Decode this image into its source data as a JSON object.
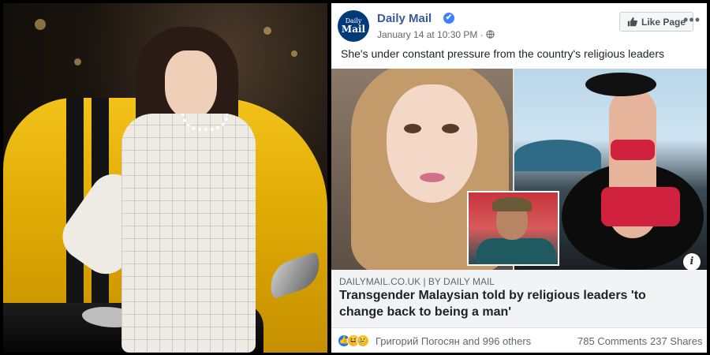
{
  "post": {
    "page_avatar_line1": "Daily",
    "page_avatar_line2": "Mail",
    "page_name": "Daily Mail",
    "verified_badge": "✔",
    "timestamp": "January 14 at 10:30 PM",
    "meta_separator": "·",
    "audience_icon": "globe-icon",
    "like_page_label": "Like Page",
    "more_icon": "more-options-icon",
    "caption": "She's under constant pressure from the country's religious leaders"
  },
  "link": {
    "source": "DAILYMAIL.CO.UK | BY DAILY MAIL",
    "title": "Transgender Malaysian told by religious leaders 'to change back to being a man'",
    "info_label": "i"
  },
  "engagement": {
    "reaction_icons": [
      "like-icon",
      "haha-icon",
      "sad-icon"
    ],
    "reaction_names": "Григорий Погосян and 996 others",
    "comments": "785 Comments",
    "shares": "237 Shares"
  },
  "colors": {
    "brand_blue": "#385898",
    "like_blue": "#1877f2",
    "car_yellow": "#f2c21a",
    "bikini_red": "#d0223e"
  }
}
